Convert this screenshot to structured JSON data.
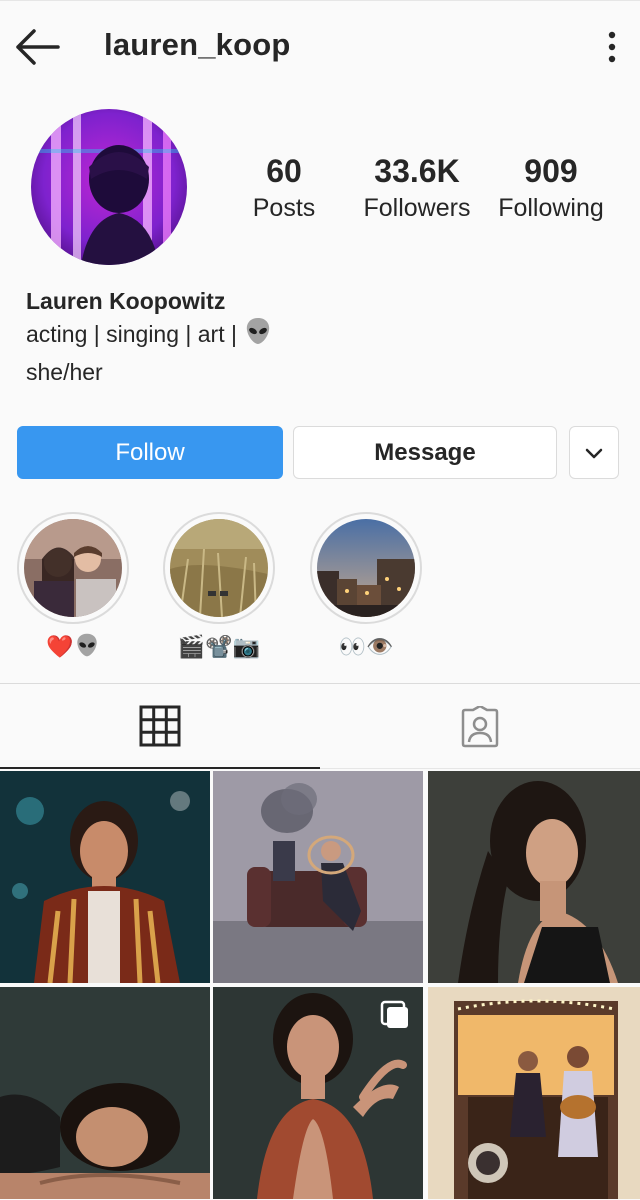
{
  "header": {
    "username": "lauren_koop",
    "back_icon": "back-arrow-icon",
    "menu_icon": "more-vertical-icon"
  },
  "profile": {
    "stats": [
      {
        "value": "60",
        "label": "Posts"
      },
      {
        "value": "33.6K",
        "label": "Followers"
      },
      {
        "value": "909",
        "label": "Following"
      }
    ],
    "name": "Lauren Koopowitz",
    "bio_line1": "acting | singing | art | ",
    "bio_line2": "she/her"
  },
  "actions": {
    "follow_label": "Follow",
    "message_label": "Message",
    "dropdown_icon": "chevron-down-icon"
  },
  "highlights": [
    {
      "caption": "❤️"
    },
    {
      "caption": "🎬📽️📷"
    },
    {
      "caption": "👀👁️"
    }
  ],
  "tabs": [
    {
      "name": "grid",
      "icon": "grid-icon",
      "active": true
    },
    {
      "name": "tagged",
      "icon": "tagged-person-icon",
      "active": false
    }
  ],
  "colors": {
    "accent": "#3897f0",
    "text": "#262626",
    "border": "#dbdbdb",
    "background": "#fafafa"
  }
}
